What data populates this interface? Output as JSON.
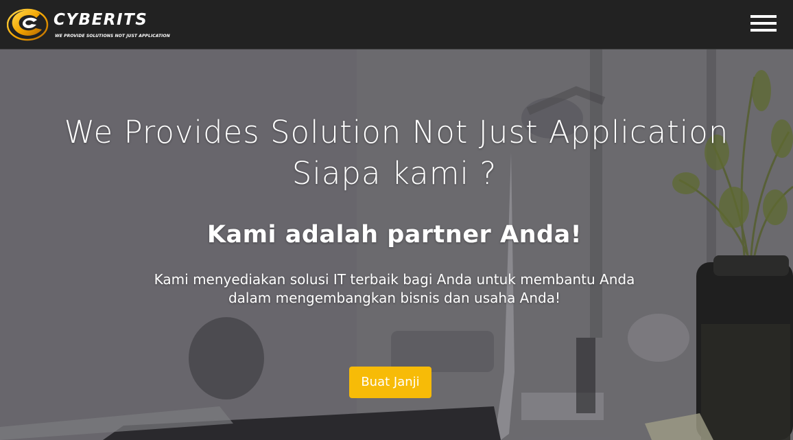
{
  "navbar": {
    "brand_name": "CYBERITS",
    "brand_tagline": "WE PROVIDE SOLUTIONS NOT JUST APPLICATION",
    "menu_icon": "hamburger-menu-icon"
  },
  "hero": {
    "title": "We Provides Solution Not Just Application",
    "subtitle": "Siapa kami ?",
    "heading": "Kami adalah partner Anda!",
    "description_line1": "Kami menyediakan solusi IT terbaik bagi Anda untuk membantu Anda",
    "description_line2": "dalam mengembangkan bisnis dan usaha Anda!",
    "cta_label": "Buat Janji"
  },
  "colors": {
    "navbar_bg": "#222222",
    "accent": "#f7bb07",
    "text": "#ffffff"
  }
}
